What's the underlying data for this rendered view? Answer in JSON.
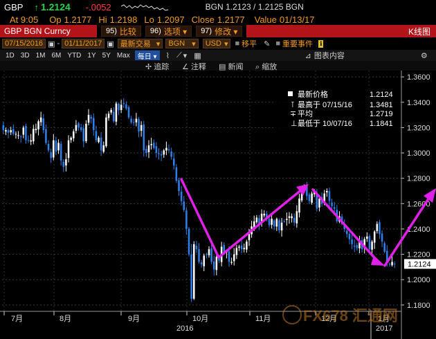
{
  "quote": {
    "ticker": "GBP",
    "last": "1.2124",
    "change": "-.0052",
    "bgn_bid_ask": "BGN 1.2123 / 1.2125 BGN",
    "time_label": "At 9:05",
    "open_label": "Op",
    "open": "1.2177",
    "high_label": "Hi",
    "high": "1.2198",
    "low_label": "Lo",
    "low": "1.2097",
    "close_label": "Close",
    "close": "1.2177",
    "value_label": "Value",
    "value_date": "01/13/17"
  },
  "menu": {
    "security": "GBP BGN Curncy",
    "items": [
      {
        "num": "95)",
        "label": "比较"
      },
      {
        "num": "96)",
        "label": "选项 ▾"
      },
      {
        "num": "97)",
        "label": "修改 ▾"
      }
    ],
    "title": "K线图"
  },
  "settings": {
    "start_date": "07/15/2016",
    "end_date": "01/11/2017",
    "type": "最新交易",
    "source": "BGN",
    "currency": "USD",
    "move_label": "移平",
    "event_label": "重要事件"
  },
  "timeframes": [
    "1D",
    "3D",
    "1M",
    "6M",
    "YTD",
    "1Y",
    "5Y",
    "Max"
  ],
  "period": "每日 ▾",
  "chart_content_label": "图表内容",
  "tools": {
    "track": "追踪",
    "annotate": "注释",
    "news": "新闻",
    "zoom": "缩放"
  },
  "legend": {
    "last_label": "最新价格",
    "last_value": "1.2124",
    "high_label": "最高于 07/15/16",
    "high_value": "1.3481",
    "avg_label": "平均",
    "avg_value": "1.2719",
    "low_label": "最低于 10/07/16",
    "low_value": "1.1841"
  },
  "watermark": "FX678 汇通网",
  "chart_data": {
    "type": "candlestick",
    "ylim": [
      1.175,
      1.365
    ],
    "yticks": [
      "1.3600",
      "1.3400",
      "1.3200",
      "1.3000",
      "1.2800",
      "1.2600",
      "1.2400",
      "1.2200",
      "1.2000",
      "1.1800"
    ],
    "xticks": [
      "7月",
      "8月",
      "9月",
      "10月",
      "11月",
      "12月",
      "1月"
    ],
    "year_labels": [
      "2016",
      "2017"
    ],
    "last_price_tag": "1.2124",
    "close_path": [
      1.318,
      1.318,
      1.316,
      1.318,
      1.315,
      1.315,
      1.314,
      1.313,
      1.32,
      1.31,
      1.31,
      1.31,
      1.319,
      1.319,
      1.325,
      1.328,
      1.318,
      1.308,
      1.302,
      1.296,
      1.31,
      1.301,
      1.308,
      1.294,
      1.289,
      1.295,
      1.31,
      1.312,
      1.317,
      1.322,
      1.32,
      1.318,
      1.309,
      1.323,
      1.33,
      1.327,
      1.318,
      1.31,
      1.312,
      1.302,
      1.306,
      1.328,
      1.331,
      1.334,
      1.325,
      1.339,
      1.334,
      1.338,
      1.339,
      1.335,
      1.328,
      1.324,
      1.324,
      1.327,
      1.317,
      1.322,
      1.302,
      1.3,
      1.306,
      1.307,
      1.304,
      1.3,
      1.299,
      1.298,
      1.302,
      1.304,
      1.302,
      1.297,
      1.29,
      1.278,
      1.27,
      1.262,
      1.255,
      1.24,
      1.22,
      1.185,
      1.228,
      1.224,
      1.214,
      1.212,
      1.219,
      1.22,
      1.224,
      1.214,
      1.208,
      1.218,
      1.215,
      1.226,
      1.222,
      1.222,
      1.214,
      1.214,
      1.22,
      1.225,
      1.226,
      1.224,
      1.225,
      1.23,
      1.236,
      1.242,
      1.246,
      1.249,
      1.244,
      1.252,
      1.252,
      1.248,
      1.243,
      1.248,
      1.242,
      1.248,
      1.239,
      1.245,
      1.246,
      1.248,
      1.25,
      1.25,
      1.245,
      1.254,
      1.264,
      1.272,
      1.274,
      1.266,
      1.262,
      1.268,
      1.27,
      1.256,
      1.264,
      1.26,
      1.268,
      1.27,
      1.262,
      1.258,
      1.256,
      1.246,
      1.25,
      1.244,
      1.24,
      1.236,
      1.232,
      1.228,
      1.226,
      1.225,
      1.23,
      1.224,
      1.232,
      1.234,
      1.224,
      1.23,
      1.238,
      1.244,
      1.236,
      1.23,
      1.222,
      1.214,
      1.212,
      1.214,
      1.2124
    ]
  }
}
